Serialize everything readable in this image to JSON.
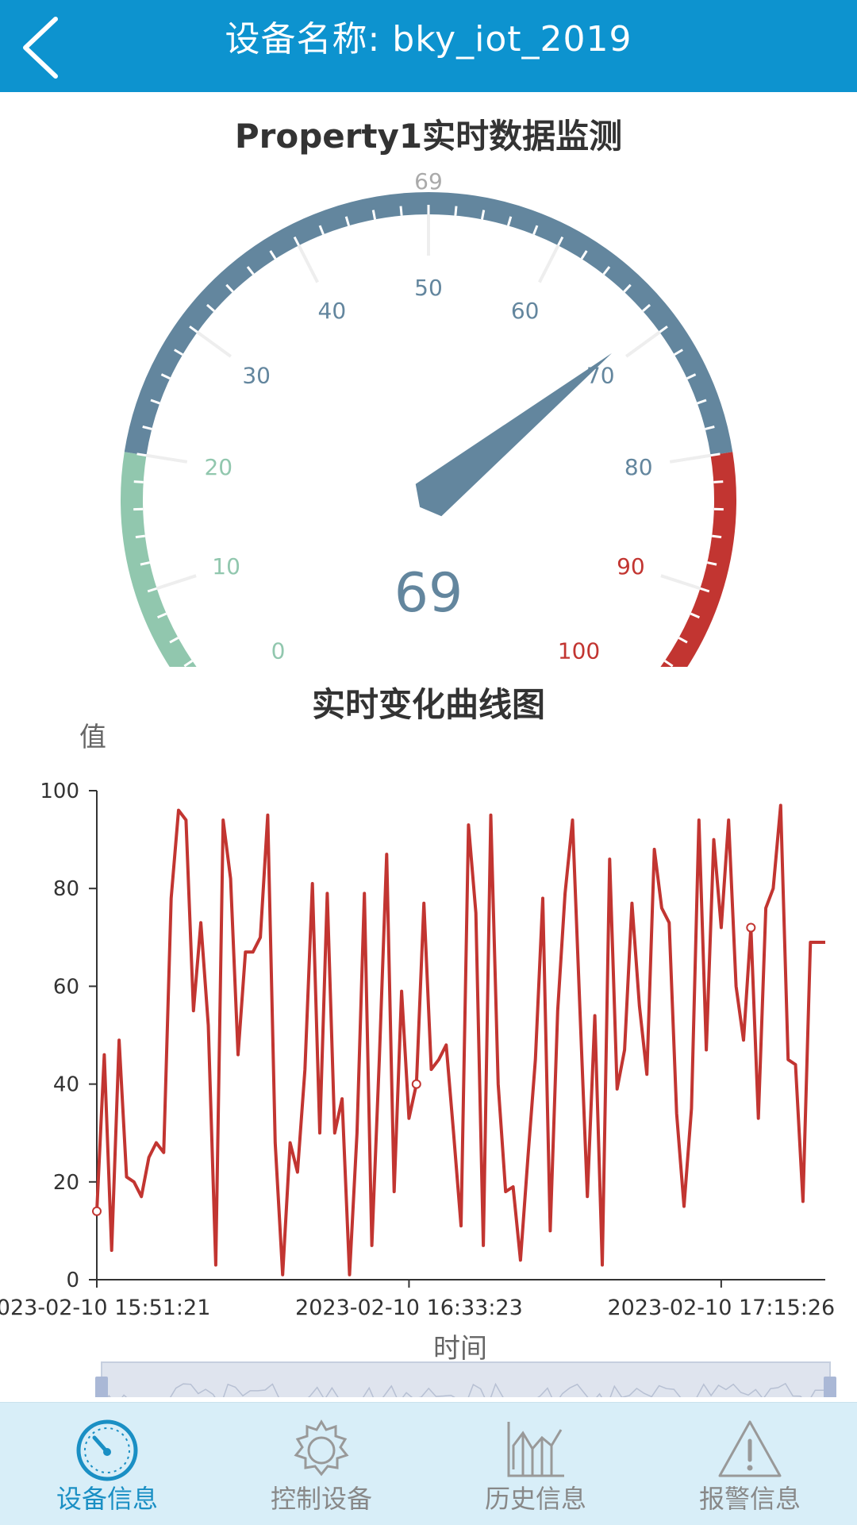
{
  "header": {
    "title": "设备名称: bky_iot_2019"
  },
  "gauge": {
    "title": "Property1实时数据监测",
    "value": 69,
    "value_label": "69",
    "top_label": "69",
    "min": 0,
    "max": 100,
    "tick_labels": [
      "0",
      "10",
      "20",
      "30",
      "40",
      "50",
      "60",
      "70",
      "80",
      "90",
      "100"
    ],
    "bands": [
      {
        "to": 20,
        "color": "#91c7ae"
      },
      {
        "to": 80,
        "color": "#63869e"
      },
      {
        "to": 100,
        "color": "#c23531"
      }
    ]
  },
  "chart": {
    "title": "实时变化曲线图",
    "ylabel": "值",
    "xlabel": "时间",
    "x_tick_labels": [
      "2023-02-10 15:51:21",
      "2023-02-10 16:33:23",
      "2023-02-10 17:15:26"
    ]
  },
  "chart_data": {
    "type": "line",
    "title": "实时变化曲线图",
    "xlabel": "时间",
    "ylabel": "值",
    "ylim": [
      0,
      100
    ],
    "y_ticks": [
      0,
      20,
      40,
      60,
      80,
      100
    ],
    "x_ticks": [
      "2023-02-10 15:51:21",
      "2023-02-10 16:33:23",
      "2023-02-10 17:15:26"
    ],
    "grid": false,
    "color": "#c23531",
    "series": [
      {
        "values": [
          14,
          46,
          6,
          49,
          21,
          20,
          17,
          25,
          28,
          26,
          78,
          96,
          94,
          55,
          73,
          52,
          3,
          94,
          82,
          46,
          67,
          67,
          70,
          95,
          28,
          1,
          28,
          22,
          43,
          81,
          30,
          79,
          30,
          37,
          1,
          30,
          79,
          7,
          45,
          87,
          18,
          59,
          33,
          40,
          77,
          43,
          45,
          48,
          30,
          11,
          93,
          75,
          7,
          95,
          40,
          18,
          19,
          4,
          25,
          45,
          78,
          10,
          55,
          79,
          94,
          55,
          17,
          54,
          3,
          86,
          39,
          47,
          77,
          56,
          42,
          88,
          76,
          73,
          34,
          15,
          35,
          94,
          47,
          90,
          72,
          94,
          60,
          49,
          72,
          33,
          76,
          80,
          97,
          45,
          44,
          16,
          69,
          69,
          69
        ]
      }
    ],
    "highlighted_points": [
      0,
      43,
      88
    ]
  },
  "tabs": [
    {
      "label": "设备信息",
      "icon": "speedometer-icon",
      "active": true
    },
    {
      "label": "控制设备",
      "icon": "gear-icon",
      "active": false
    },
    {
      "label": "历史信息",
      "icon": "history-chart-icon",
      "active": false
    },
    {
      "label": "报警信息",
      "icon": "warning-icon",
      "active": false
    }
  ],
  "colors": {
    "header": "#0d93cf",
    "tabbar": "#d8eef8",
    "active_tab": "#1a8fc4",
    "line": "#c23531"
  }
}
